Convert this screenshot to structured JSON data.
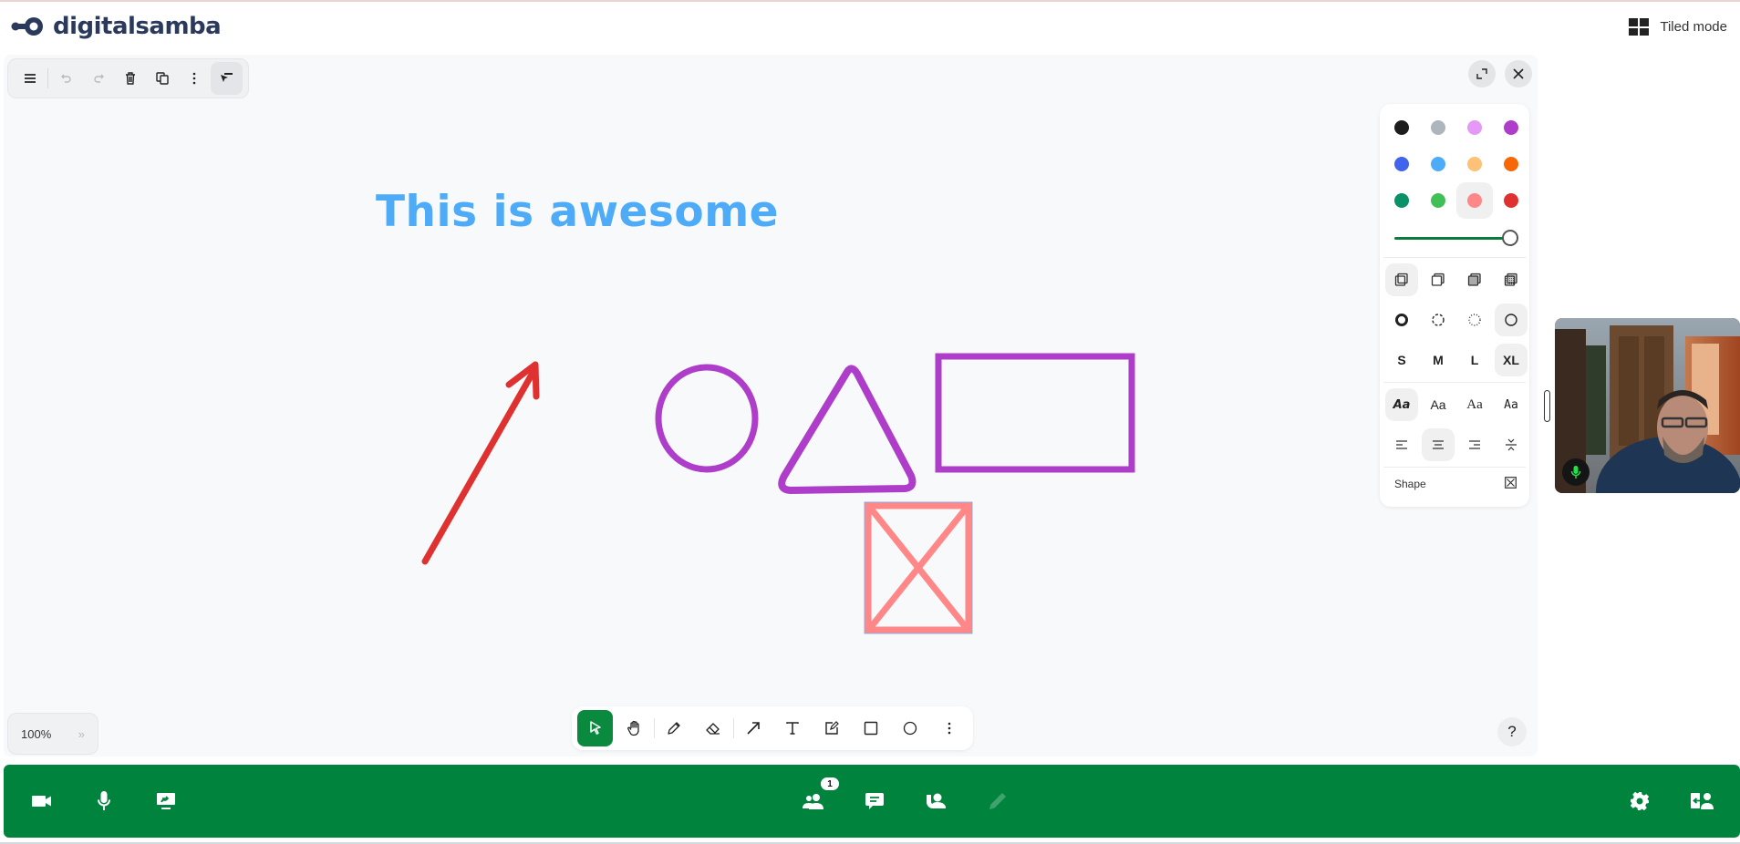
{
  "header": {
    "brand": "digitalsamba",
    "tiled_mode_label": "Tiled mode"
  },
  "top_toolbar": {
    "items": [
      {
        "name": "menu",
        "icon": "hamburger-icon",
        "enabled": true
      },
      {
        "name": "undo",
        "icon": "undo-icon",
        "enabled": false
      },
      {
        "name": "redo",
        "icon": "redo-icon",
        "enabled": false
      },
      {
        "name": "delete",
        "icon": "trash-icon",
        "enabled": true
      },
      {
        "name": "duplicate",
        "icon": "duplicate-icon",
        "enabled": true
      },
      {
        "name": "more",
        "icon": "more-vertical-icon",
        "enabled": true
      },
      {
        "name": "style-panel-toggle",
        "icon": "cursor-panel-icon",
        "enabled": true,
        "active": true
      }
    ]
  },
  "board": {
    "text_element": "This is awesome",
    "text_color": "#4dabf7",
    "shapes": [
      {
        "type": "arrow",
        "color": "#e03131"
      },
      {
        "type": "ellipse",
        "color": "#ae3ec9"
      },
      {
        "type": "triangle",
        "color": "#ae3ec9"
      },
      {
        "type": "rectangle",
        "color": "#ae3ec9"
      },
      {
        "type": "x-box",
        "color": "#ff8787",
        "selected": true
      }
    ]
  },
  "style_panel": {
    "colors": [
      {
        "name": "black",
        "hex": "#1d1d1d"
      },
      {
        "name": "grey",
        "hex": "#adb5bd"
      },
      {
        "name": "light-violet",
        "hex": "#e599f7"
      },
      {
        "name": "violet",
        "hex": "#ae3ec9"
      },
      {
        "name": "blue",
        "hex": "#4263eb"
      },
      {
        "name": "light-blue",
        "hex": "#4dabf7"
      },
      {
        "name": "yellow",
        "hex": "#ffc078"
      },
      {
        "name": "orange",
        "hex": "#f76707"
      },
      {
        "name": "green",
        "hex": "#099268"
      },
      {
        "name": "light-green",
        "hex": "#40c057"
      },
      {
        "name": "light-red",
        "hex": "#ff8787"
      },
      {
        "name": "red",
        "hex": "#e03131"
      }
    ],
    "selected_color": "light-red",
    "opacity": 1.0,
    "fill_options": [
      "none",
      "semi",
      "solid",
      "pattern"
    ],
    "selected_fill": "none",
    "dash_options": [
      "draw",
      "dashed",
      "dotted",
      "solid"
    ],
    "selected_dash": "solid",
    "size_options": [
      "S",
      "M",
      "L",
      "XL"
    ],
    "selected_size": "XL",
    "font_options": [
      "Aa",
      "Aa",
      "Aa",
      "Aa"
    ],
    "font_names": [
      "draw",
      "sans",
      "serif",
      "mono"
    ],
    "selected_font": "draw",
    "align_options": [
      "align-left",
      "align-center",
      "align-right",
      "vertical-align"
    ],
    "selected_align": "align-center",
    "shape_label": "Shape"
  },
  "bottom_toolbar": {
    "tools": [
      {
        "name": "select",
        "icon": "cursor-icon",
        "active": true
      },
      {
        "name": "hand",
        "icon": "hand-icon"
      },
      {
        "name": "draw",
        "icon": "pencil-icon"
      },
      {
        "name": "eraser",
        "icon": "eraser-icon"
      },
      {
        "name": "arrow",
        "icon": "arrow-icon"
      },
      {
        "name": "text",
        "icon": "text-icon"
      },
      {
        "name": "note",
        "icon": "note-icon"
      },
      {
        "name": "rectangle",
        "icon": "rectangle-icon"
      },
      {
        "name": "ellipse",
        "icon": "ellipse-icon"
      },
      {
        "name": "more",
        "icon": "more-vertical-icon"
      }
    ]
  },
  "zoom": {
    "value": "100%",
    "more": "»"
  },
  "help": "?",
  "video": {
    "mic_active": true
  },
  "control_bar": {
    "participants_count": "1",
    "left": [
      "camera",
      "microphone",
      "screen-share"
    ],
    "center": [
      "participants",
      "chat",
      "raise-hand",
      "whiteboard"
    ],
    "right": [
      "settings",
      "leave"
    ]
  }
}
